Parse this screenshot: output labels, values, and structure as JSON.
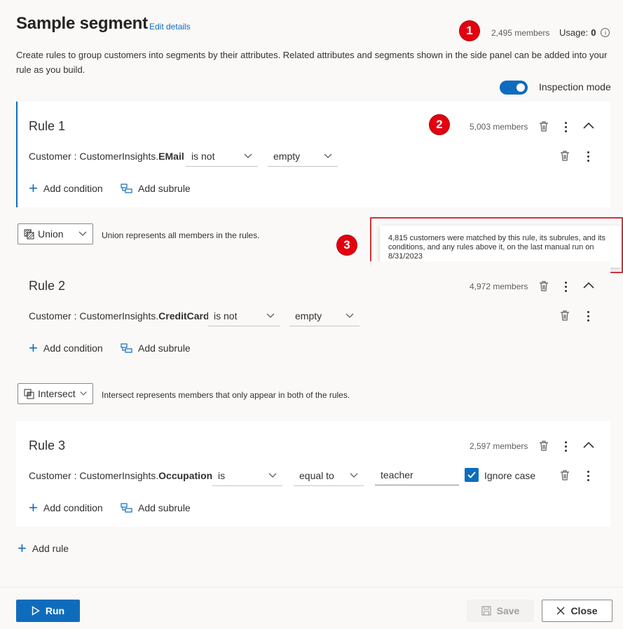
{
  "header": {
    "title": "Sample segment",
    "edit_link": "Edit details",
    "members": "2,495 members",
    "usage_label": "Usage:",
    "usage_value": "0",
    "description": "Create rules to group customers into segments by their attributes. Related attributes and segments shown in the side panel can be added into your rule as you build.",
    "inspection_label": "Inspection mode",
    "inspection_on": true
  },
  "badges": [
    "1",
    "2",
    "3"
  ],
  "tooltip": "4,815 customers were matched by this rule, its subrules, and its conditions, and any rules above it, on the last manual run on 8/31/2023",
  "rules": [
    {
      "title": "Rule 1",
      "members": "5,003 members",
      "attr_prefix": "Customer : CustomerInsights.",
      "attr_name": "EMail",
      "operator": "is not",
      "value": "empty"
    },
    {
      "title": "Rule 2",
      "members": "4,972 members",
      "attr_prefix": "Customer : CustomerInsights.",
      "attr_name": "CreditCard",
      "operator": "is not",
      "value": "empty"
    },
    {
      "title": "Rule 3",
      "members": "2,597 members",
      "attr_prefix": "Customer : CustomerInsights.",
      "attr_name": "Occupation",
      "operator": "is",
      "comparator": "equal to",
      "text_value": "teacher",
      "ignore_case_label": "Ignore case",
      "ignore_case": true
    }
  ],
  "actions": {
    "add_condition": "Add condition",
    "add_subrule": "Add subrule",
    "add_rule": "Add rule"
  },
  "combinators": [
    {
      "label": "Union",
      "description": "Union represents all members in the rules."
    },
    {
      "label": "Intersect",
      "description": "Intersect represents members that only appear in both of the rules."
    }
  ],
  "footer": {
    "run": "Run",
    "save": "Save",
    "close": "Close"
  },
  "colors": {
    "accent": "#0f6cbd",
    "badge": "#e3000f",
    "highlight_border": "#d13438"
  }
}
